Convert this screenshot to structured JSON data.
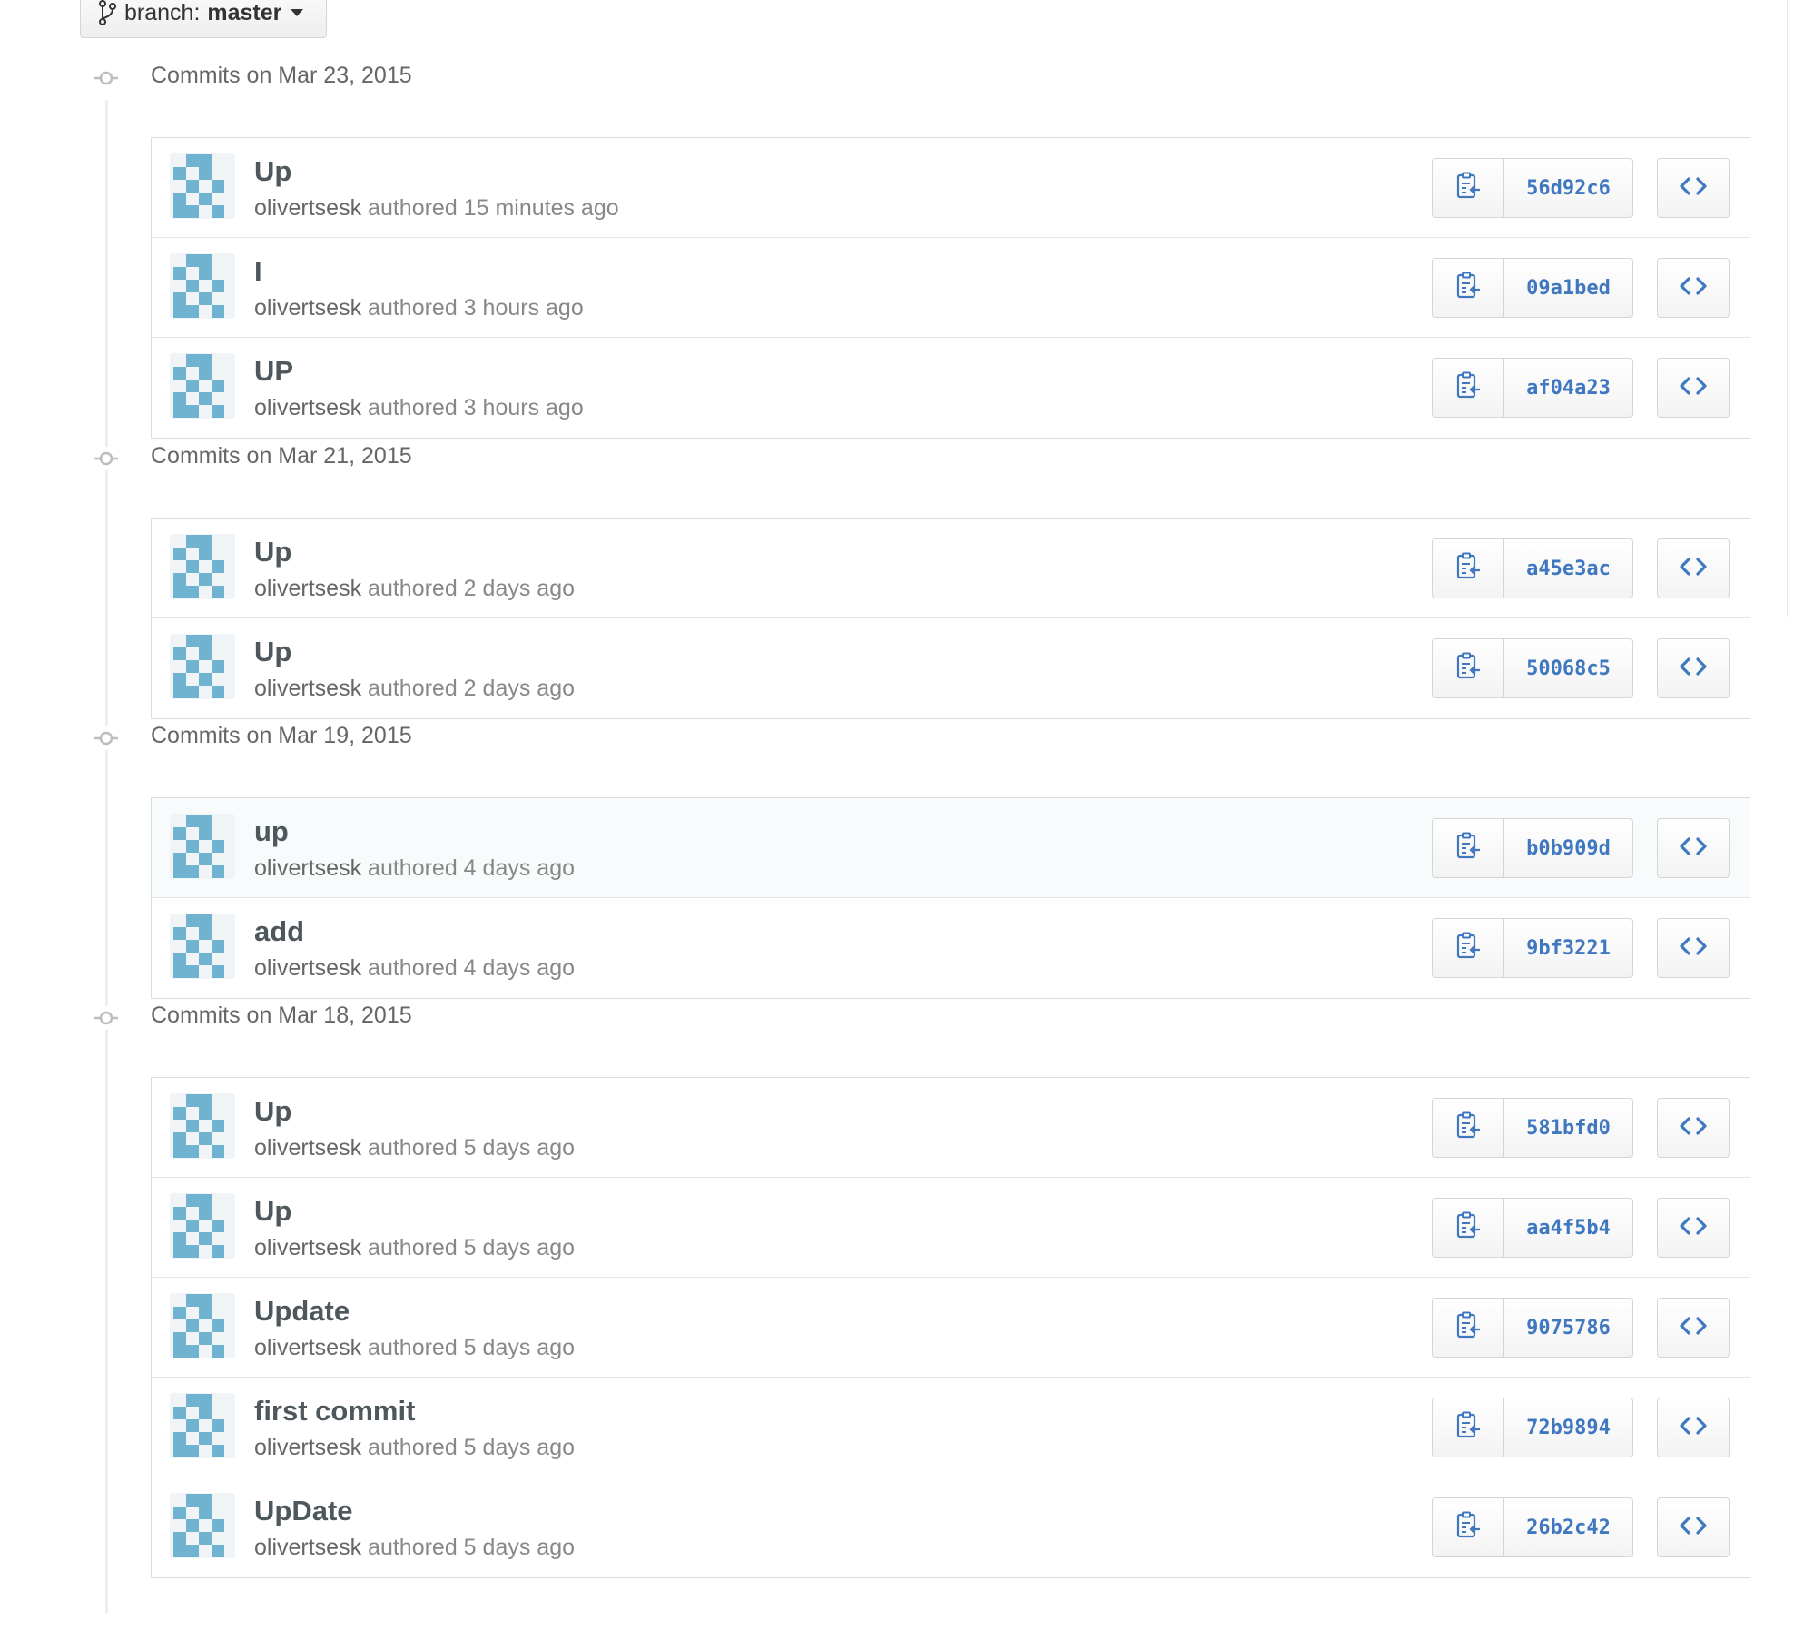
{
  "branch_selector": {
    "prefix": "branch:",
    "name": "master",
    "icon": "git-branch-icon"
  },
  "colors": {
    "sha_link": "#4078c0",
    "avatar_identicon": "#6fb3d0"
  },
  "groups": [
    {
      "title": "Commits on Mar 23, 2015",
      "commits": [
        {
          "title": "Up",
          "author": "olivertsesk",
          "meta": "authored 15 minutes ago",
          "sha": "56d92c6"
        },
        {
          "title": "I",
          "author": "olivertsesk",
          "meta": "authored 3 hours ago",
          "sha": "09a1bed"
        },
        {
          "title": "UP",
          "author": "olivertsesk",
          "meta": "authored 3 hours ago",
          "sha": "af04a23"
        }
      ]
    },
    {
      "title": "Commits on Mar 21, 2015",
      "commits": [
        {
          "title": "Up",
          "author": "olivertsesk",
          "meta": "authored 2 days ago",
          "sha": "a45e3ac"
        },
        {
          "title": "Up",
          "author": "olivertsesk",
          "meta": "authored 2 days ago",
          "sha": "50068c5"
        }
      ]
    },
    {
      "title": "Commits on Mar 19, 2015",
      "commits": [
        {
          "title": "up",
          "author": "olivertsesk",
          "meta": "authored 4 days ago",
          "sha": "b0b909d",
          "highlighted": true
        },
        {
          "title": "add",
          "author": "olivertsesk",
          "meta": "authored 4 days ago",
          "sha": "9bf3221"
        }
      ]
    },
    {
      "title": "Commits on Mar 18, 2015",
      "commits": [
        {
          "title": "Up",
          "author": "olivertsesk",
          "meta": "authored 5 days ago",
          "sha": "581bfd0"
        },
        {
          "title": "Up",
          "author": "olivertsesk",
          "meta": "authored 5 days ago",
          "sha": "aa4f5b4"
        },
        {
          "title": "Update",
          "author": "olivertsesk",
          "meta": "authored 5 days ago",
          "sha": "9075786"
        },
        {
          "title": "first commit",
          "author": "olivertsesk",
          "meta": "authored 5 days ago",
          "sha": "72b9894"
        },
        {
          "title": "UpDate",
          "author": "olivertsesk",
          "meta": "authored 5 days ago",
          "sha": "26b2c42"
        }
      ]
    }
  ]
}
